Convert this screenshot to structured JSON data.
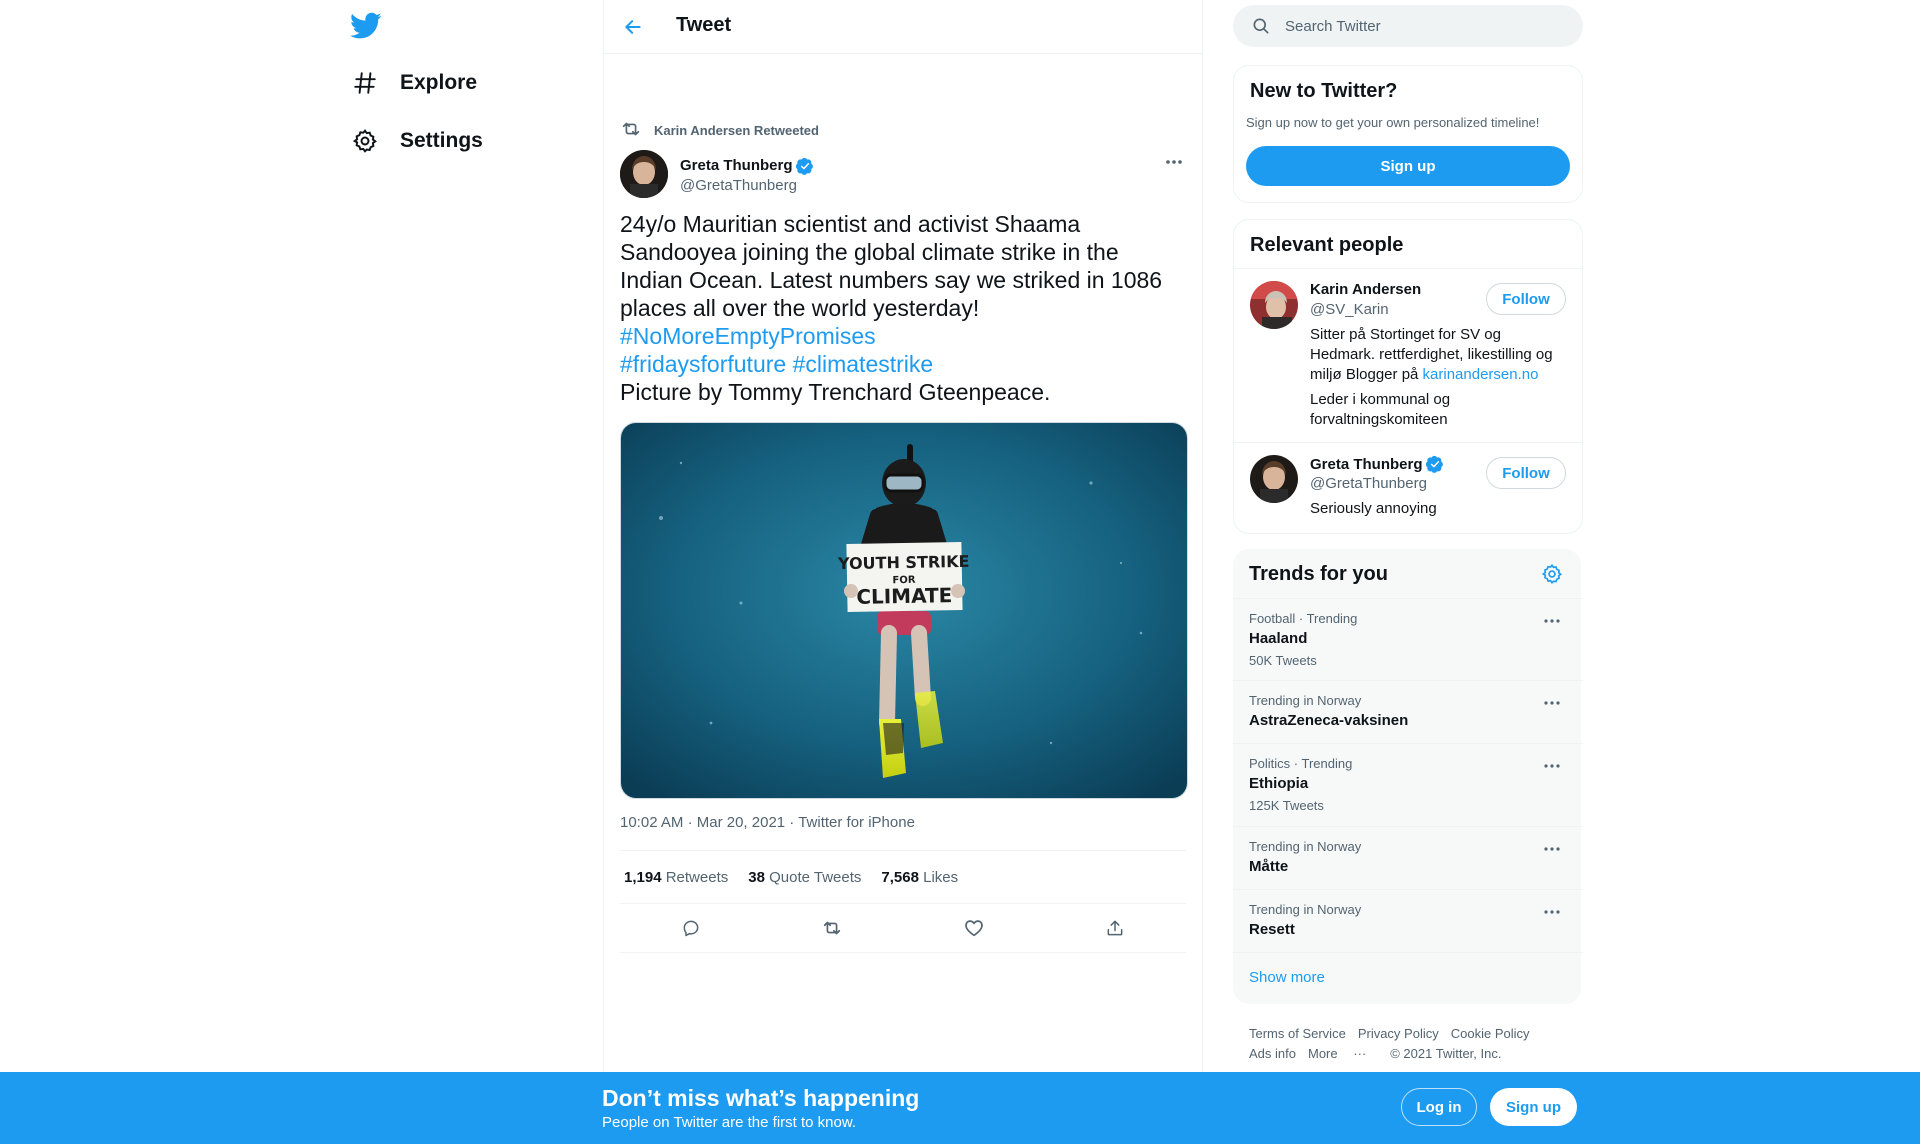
{
  "colors": {
    "accent": "#1d9bf0",
    "text": "#0f1419",
    "muted": "#536471",
    "border": "#eff3f4"
  },
  "nav": {
    "logo_icon": "twitter-bird-icon",
    "items": [
      {
        "label": "Explore",
        "icon": "hashtag-icon"
      },
      {
        "label": "Settings",
        "icon": "gear-icon"
      }
    ]
  },
  "header": {
    "title": "Tweet",
    "back_icon": "arrow-left-icon"
  },
  "tweet": {
    "retweeted_by": "Karin Andersen Retweeted",
    "author": {
      "name": "Greta Thunberg",
      "handle": "@GretaThunberg",
      "verified": true
    },
    "text_lines": [
      "24y/o Mauritian scientist and activist Shaama",
      "Sandooyea joining the global climate strike in the",
      "Indian Ocean. Latest numbers say we striked in 1086",
      "places all over the world yesterday!"
    ],
    "hashtags": [
      "#NoMoreEmptyPromises",
      "#fridaysforfuture",
      "#climatestrike"
    ],
    "text_tail": "Picture by Tommy Trenchard Gteenpeace.",
    "image_sign": [
      "YOUTH STRIKE",
      "FOR",
      "CLIMATE"
    ],
    "time": "10:02 AM",
    "date": "Mar 20, 2021",
    "source": "Twitter for iPhone",
    "separator": "·",
    "stats": [
      {
        "count": "1,194",
        "label": "Retweets"
      },
      {
        "count": "38",
        "label": "Quote Tweets"
      },
      {
        "count": "7,568",
        "label": "Likes"
      }
    ]
  },
  "search": {
    "placeholder": "Search Twitter"
  },
  "new_to_twitter": {
    "title": "New to Twitter?",
    "subtitle": "Sign up now to get your own personalized timeline!",
    "button": "Sign up"
  },
  "relevant_people": {
    "title": "Relevant people",
    "people": [
      {
        "name": "Karin Andersen",
        "handle": "@SV_Karin",
        "bio_lines": [
          "Sitter på Stortinget for SV og",
          "Hedmark. rettferdighet, likestilling og",
          "miljø Blogger på "
        ],
        "bio_link": "karinandersen.no",
        "bio2_lines": [
          "Leder i kommunal og",
          "forvaltningskomiteen"
        ],
        "follow": "Follow"
      },
      {
        "name": "Greta Thunberg",
        "handle": "@GretaThunberg",
        "verified": true,
        "bio": "Seriously annoying",
        "follow": "Follow"
      }
    ]
  },
  "trends": {
    "title": "Trends for you",
    "items": [
      {
        "meta": "Football · Trending",
        "name": "Haaland",
        "count": "50K Tweets"
      },
      {
        "meta": "Trending in Norway",
        "name": "AstraZeneca-vaksinen",
        "count": ""
      },
      {
        "meta": "Politics · Trending",
        "name": "Ethiopia",
        "count": "125K Tweets"
      },
      {
        "meta": "Trending in Norway",
        "name": "Måtte",
        "count": ""
      },
      {
        "meta": "Trending in Norway",
        "name": "Resett",
        "count": ""
      }
    ],
    "show_more": "Show more"
  },
  "footer": {
    "links": [
      "Terms of Service",
      "Privacy Policy",
      "Cookie Policy",
      "Ads info",
      "More"
    ],
    "more_glyph": "···",
    "copyright": "© 2021 Twitter, Inc."
  },
  "banner": {
    "title": "Don’t miss what’s happening",
    "subtitle": "People on Twitter are the first to know.",
    "login": "Log in",
    "signup": "Sign up"
  }
}
